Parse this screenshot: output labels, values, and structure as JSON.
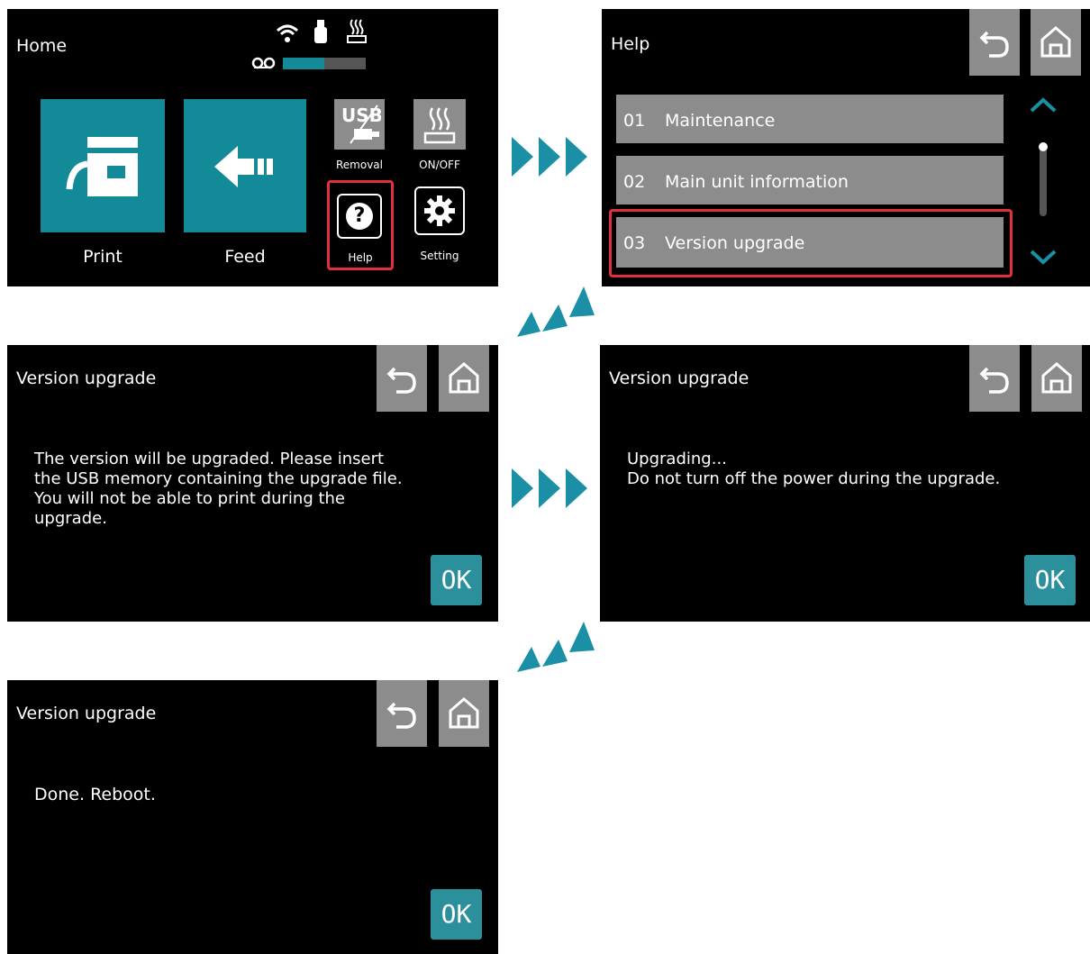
{
  "home": {
    "title": "Home",
    "tiles": [
      {
        "label": "Print",
        "icon": "printer-icon"
      },
      {
        "label": "Feed",
        "icon": "feed-arrow-icon"
      }
    ],
    "small_buttons": [
      {
        "label": "Removal",
        "icon": "usb-removal-icon"
      },
      {
        "label": "ON/OFF",
        "icon": "heater-icon"
      },
      {
        "label": "Help",
        "icon": "help-icon"
      },
      {
        "label": "Setting",
        "icon": "gear-icon"
      }
    ],
    "status_icons": [
      "wifi-icon",
      "usb-icon",
      "heater-icon",
      "ribbon-icon"
    ],
    "ribbon_level": 0.5
  },
  "help": {
    "title": "Help",
    "items": [
      {
        "num": "01",
        "label": "Maintenance"
      },
      {
        "num": "02",
        "label": "Main unit information"
      },
      {
        "num": "03",
        "label": "Version upgrade"
      }
    ]
  },
  "upgrade_prompt": {
    "title": "Version upgrade",
    "message": "The version will be upgraded. Please insert\nthe USB memory containing the upgrade file.\nYou will not be able to print during the\nupgrade.",
    "ok_label": "OK"
  },
  "upgrading": {
    "title": "Version upgrade",
    "message": "Upgrading...\nDo not turn off the power during the upgrade.",
    "ok_label": "OK"
  },
  "done": {
    "title": "Version upgrade",
    "message": "Done. Reboot.",
    "ok_label": "OK"
  },
  "colors": {
    "accent": "#138a97",
    "highlight": "#e0313d",
    "button_gray": "#8c8c8c"
  }
}
